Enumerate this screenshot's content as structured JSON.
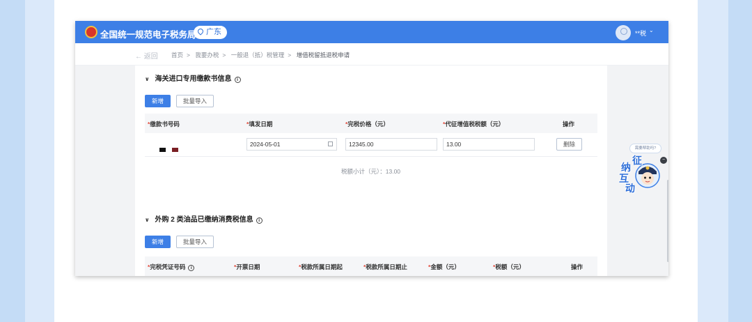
{
  "header": {
    "site_title": "全国统一规范电子税务局",
    "region": "广东",
    "user_name": "**税"
  },
  "breadcrumb": {
    "back_label": "返回",
    "items": [
      "首页",
      "我要办税",
      "一般退（抵）税管理",
      "增值税留抵退税申请"
    ]
  },
  "section1": {
    "title": "海关进口专用缴款书信息",
    "add_label": "新增",
    "import_label": "批量导入",
    "columns": [
      "缴款书号码",
      "填发日期",
      "完税价格（元）",
      "代征增值税税额（元）",
      "操作"
    ],
    "row": {
      "date": "2024-05-01",
      "price": "12345.00",
      "tax": "13.00",
      "delete_label": "删除"
    },
    "subtotal_label": "税额小计（元）：13.00"
  },
  "section2": {
    "title": "外购 2 类油品已缴纳消费税信息",
    "add_label": "新增",
    "import_label": "批量导入",
    "columns": [
      "完税凭证号码",
      "开票日期",
      "税款所属日期起",
      "税款所属日期止",
      "金额（元）",
      "税额（元）",
      "操作"
    ]
  },
  "helper": {
    "bubble_text": "需要帮助吗?",
    "chars": [
      "征",
      "纳",
      "互",
      "动"
    ]
  },
  "colors": {
    "accent": "#3d7fe6",
    "required": "#e24a3b"
  },
  "icons": [
    "emblem-icon",
    "location-pin-icon",
    "user-avatar-icon",
    "chevron-down-icon",
    "back-arrow-icon",
    "info-icon",
    "calendar-icon",
    "close-icon"
  ]
}
